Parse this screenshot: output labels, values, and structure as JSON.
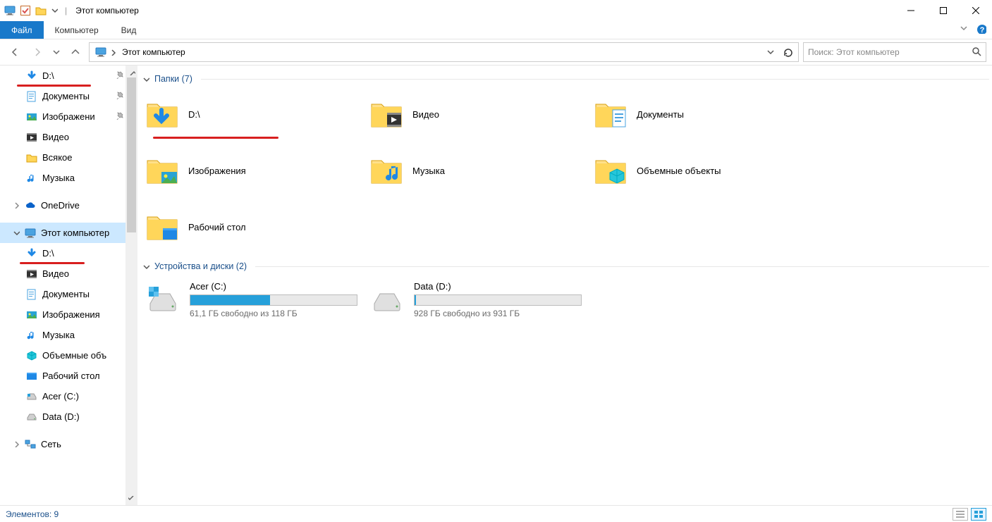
{
  "title": "Этот компьютер",
  "ribbon": {
    "file": "Файл",
    "tabs": [
      "Компьютер",
      "Вид"
    ]
  },
  "breadcrumb": "Этот компьютер",
  "search_placeholder": "Поиск: Этот компьютер",
  "tree": {
    "quick": [
      {
        "label": "D:\\",
        "pinned": true,
        "icon": "down"
      },
      {
        "label": "Документы",
        "pinned": true,
        "icon": "doc"
      },
      {
        "label": "Изображени",
        "pinned": true,
        "icon": "pic"
      },
      {
        "label": "Видео",
        "icon": "vid"
      },
      {
        "label": "Всякое",
        "icon": "folder"
      },
      {
        "label": "Музыка",
        "icon": "music"
      }
    ],
    "onedrive": "OneDrive",
    "thispc": "Этот компьютер",
    "pc_children": [
      {
        "label": "D:\\",
        "icon": "down"
      },
      {
        "label": "Видео",
        "icon": "vid"
      },
      {
        "label": "Документы",
        "icon": "doc"
      },
      {
        "label": "Изображения",
        "icon": "pic"
      },
      {
        "label": "Музыка",
        "icon": "music"
      },
      {
        "label": "Объемные объ",
        "icon": "cube"
      },
      {
        "label": "Рабочий стол",
        "icon": "desk"
      },
      {
        "label": "Acer (C:)",
        "icon": "cdrive"
      },
      {
        "label": "Data (D:)",
        "icon": "drive"
      }
    ],
    "network": "Сеть"
  },
  "groups": {
    "folders": {
      "title": "Папки",
      "count": 7
    },
    "devices": {
      "title": "Устройства и диски",
      "count": 2
    }
  },
  "folders": [
    {
      "label": "D:\\",
      "icon": "down"
    },
    {
      "label": "Видео",
      "icon": "vid"
    },
    {
      "label": "Документы",
      "icon": "doc"
    },
    {
      "label": "Изображения",
      "icon": "pic"
    },
    {
      "label": "Музыка",
      "icon": "music"
    },
    {
      "label": "Объемные объекты",
      "icon": "cube"
    },
    {
      "label": "Рабочий стол",
      "icon": "desk"
    }
  ],
  "drives": [
    {
      "label": "Acer (C:)",
      "free": "61,1 ГБ свободно из 118 ГБ",
      "fill_pct": 48,
      "icon": "cdrive"
    },
    {
      "label": "Data (D:)",
      "free": "928 ГБ свободно из 931 ГБ",
      "fill_pct": 1,
      "icon": "drive"
    }
  ],
  "status": "Элементов: 9"
}
